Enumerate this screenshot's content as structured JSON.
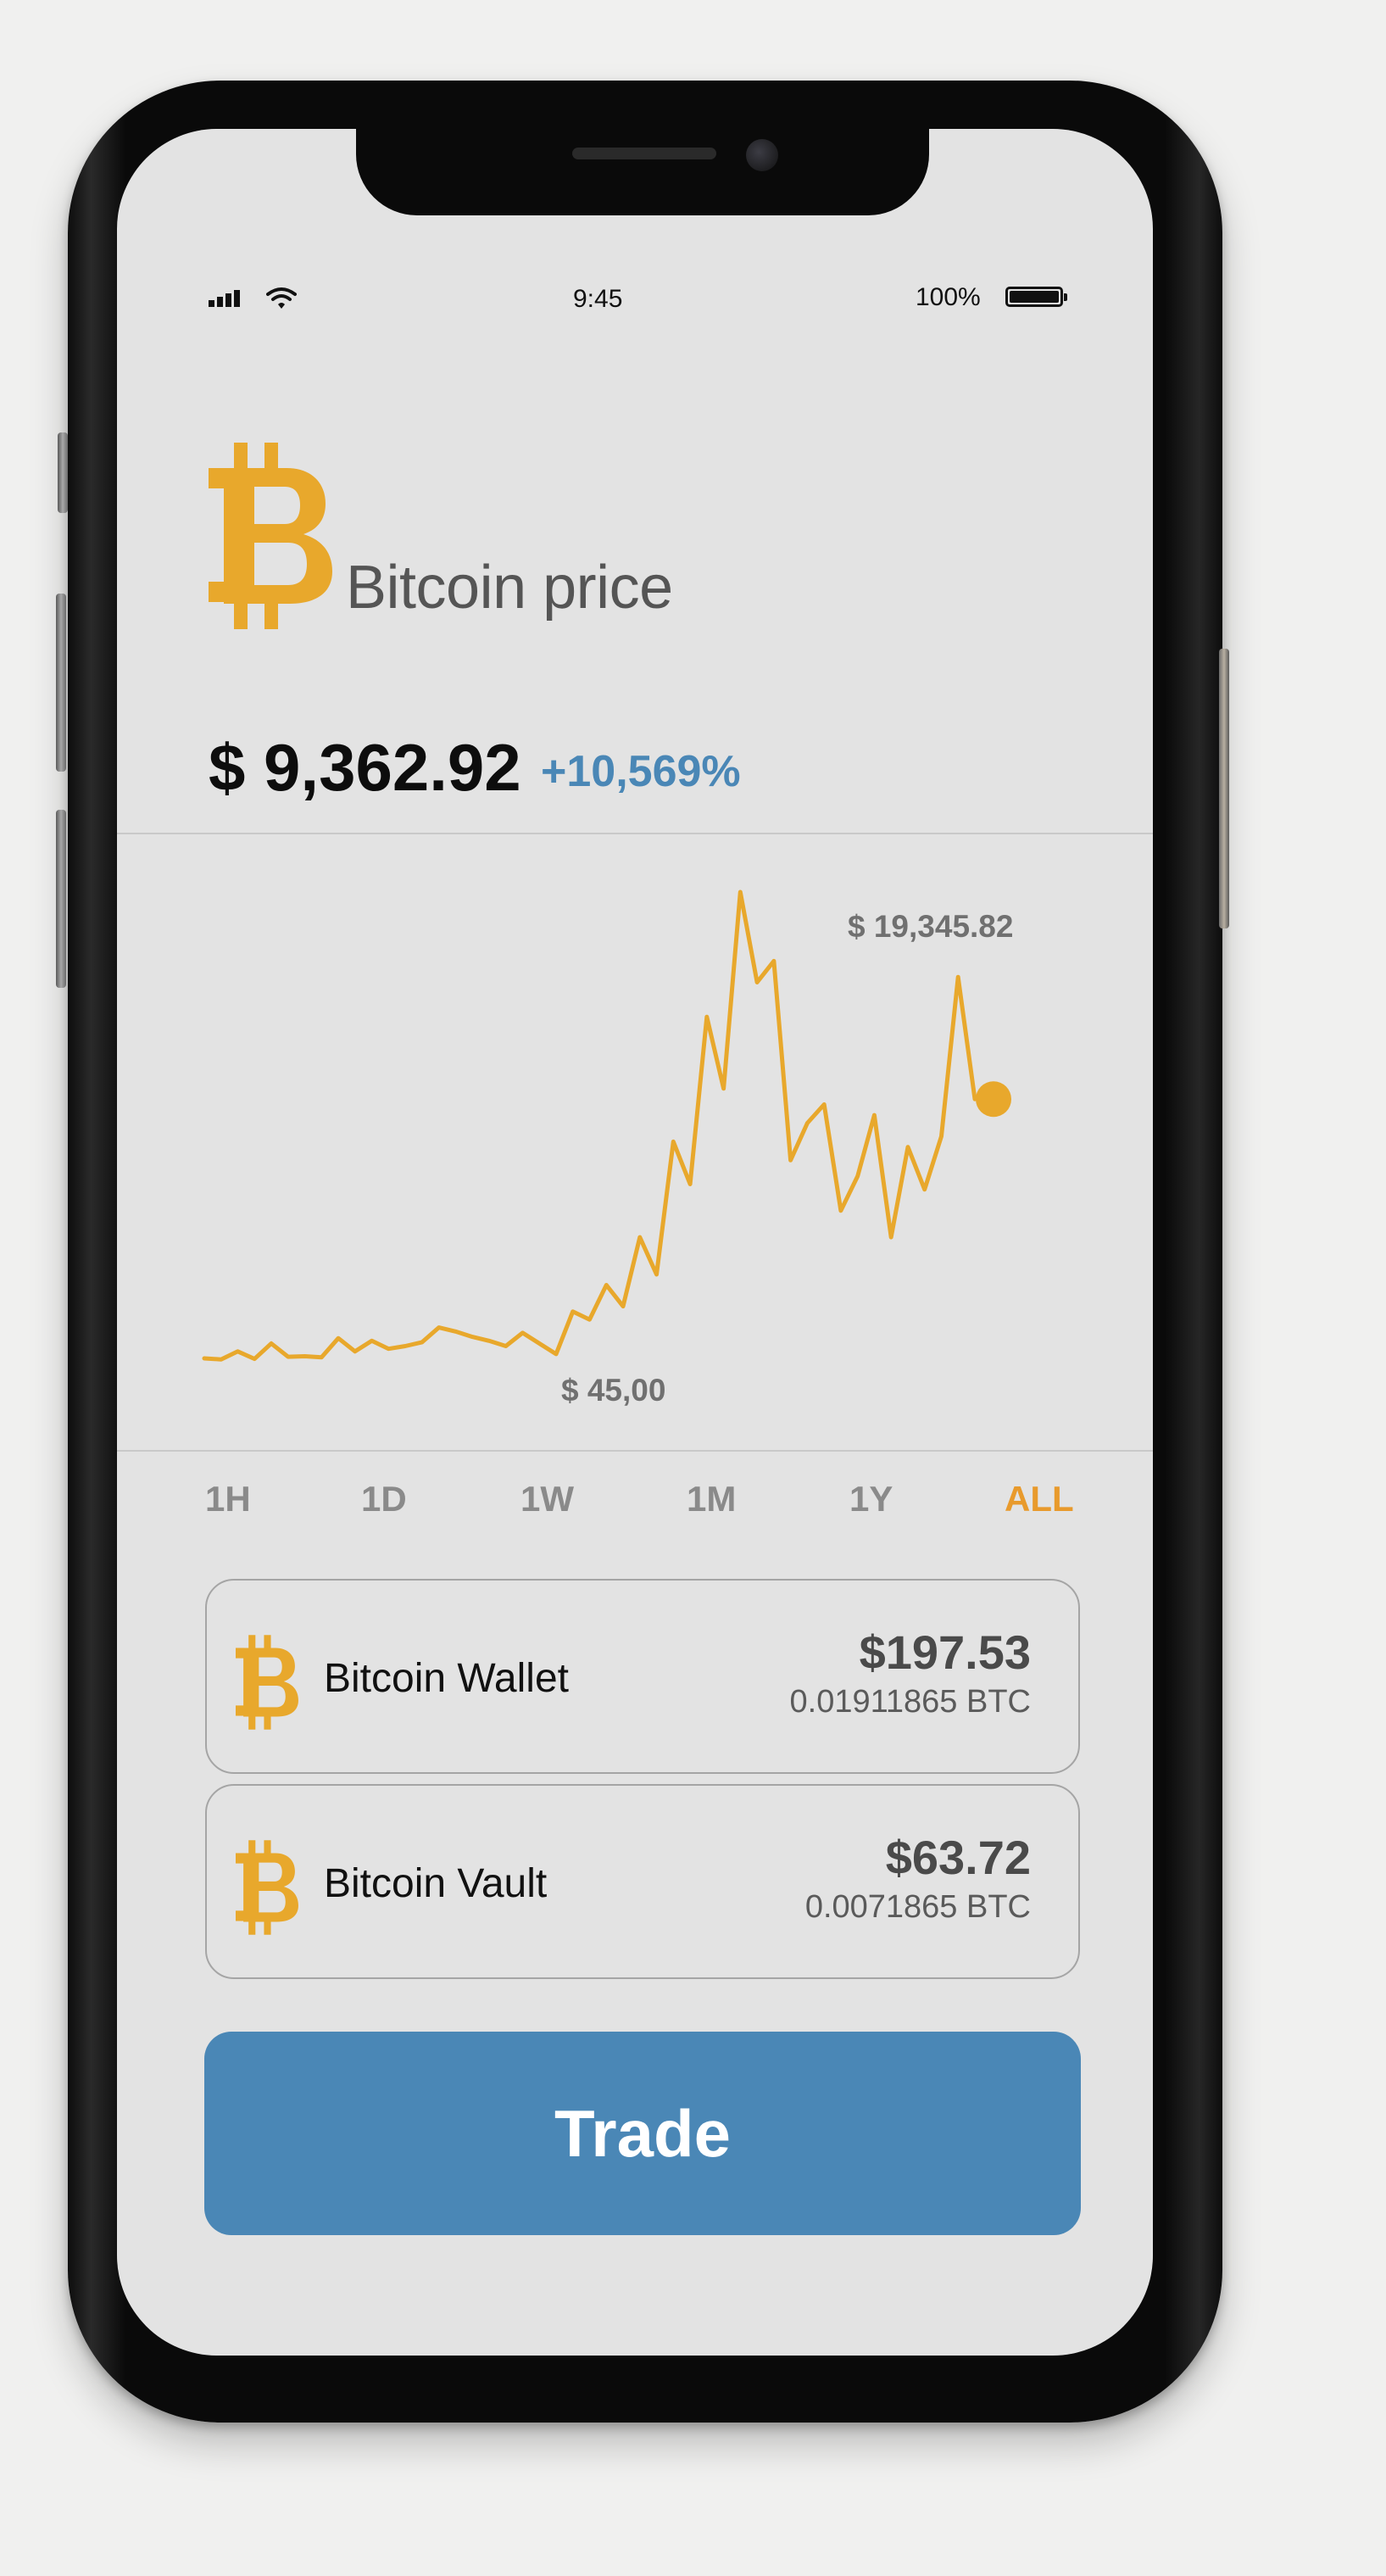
{
  "status_bar": {
    "time": "9:45",
    "battery": "100%"
  },
  "header": {
    "title": "Bitcoin price",
    "price": "$ 9,362.92",
    "change": "+10,569%"
  },
  "colors": {
    "bitcoin": "#e8a82c",
    "accent_blue": "#4a87b6",
    "active_tab": "#e89a2c"
  },
  "chart_data": {
    "type": "line",
    "annotations": {
      "high": "$ 19,345.82",
      "low": "$ 45,00"
    },
    "values": [
      640,
      600,
      900,
      620,
      1200,
      700,
      720,
      680,
      1400,
      900,
      1300,
      1000,
      1100,
      1250,
      1800,
      1650,
      1450,
      1300,
      1100,
      1600,
      1200,
      800,
      2400,
      2100,
      3400,
      2600,
      5200,
      3800,
      8800,
      7200,
      13500,
      10800,
      18200,
      14800,
      15600,
      8100,
      9500,
      10200,
      6200,
      7500,
      9800,
      5200,
      8600,
      7000,
      9000,
      15000,
      10400
    ],
    "last_value": 10400
  },
  "range_tabs": [
    {
      "label": "1H"
    },
    {
      "label": "1D"
    },
    {
      "label": "1W"
    },
    {
      "label": "1M"
    },
    {
      "label": "1Y"
    },
    {
      "label": "ALL"
    }
  ],
  "active_range": "ALL",
  "accounts": [
    {
      "name": "Bitcoin Wallet",
      "fiat": "$197.53",
      "crypto": "0.01911865 BTC"
    },
    {
      "name": "Bitcoin Vault",
      "fiat": "$63.72",
      "crypto": "0.0071865 BTC"
    }
  ],
  "trade_label": "Trade"
}
